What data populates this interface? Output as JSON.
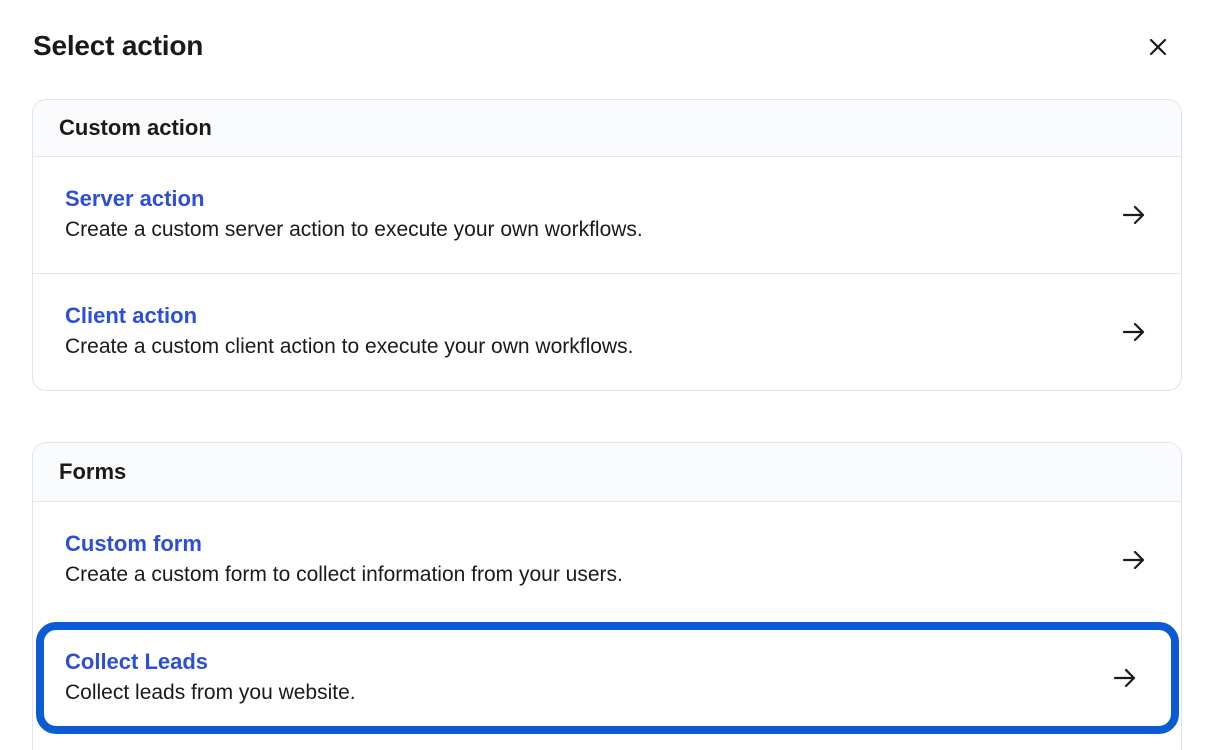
{
  "dialog": {
    "title": "Select action",
    "close_icon": "close-icon"
  },
  "sections": [
    {
      "header": "Custom action",
      "options": [
        {
          "title": "Server action",
          "description": "Create a custom server action to execute your own workflows.",
          "icon": "arrow-right-icon"
        },
        {
          "title": "Client action",
          "description": "Create a custom client action to execute your own workflows.",
          "icon": "arrow-right-icon"
        }
      ]
    },
    {
      "header": "Forms",
      "options": [
        {
          "title": "Custom form",
          "description": "Create a custom form to collect information from your users.",
          "icon": "arrow-right-icon"
        },
        {
          "title": "Collect Leads",
          "description": "Collect leads from you website.",
          "icon": "arrow-right-icon",
          "selected": true
        }
      ]
    }
  ],
  "colors": {
    "accent": "#2c4fd6",
    "selection_border": "#0b5bd3",
    "border": "#e1e3ea",
    "header_bg": "#fafbfd"
  }
}
